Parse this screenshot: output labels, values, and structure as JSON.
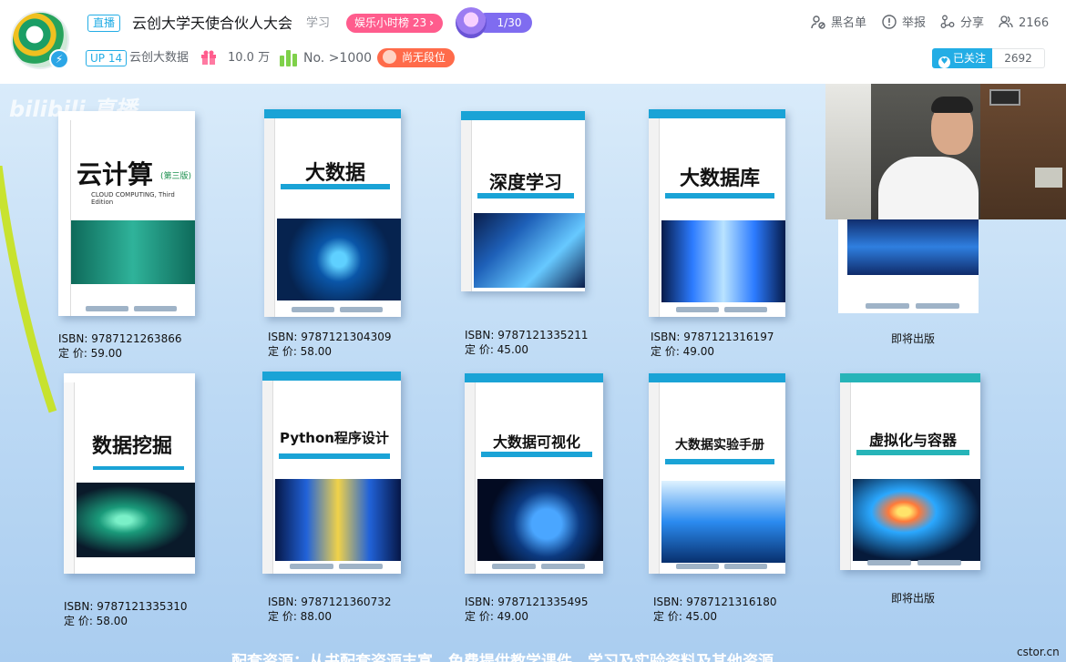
{
  "header": {
    "live_tag": "直播",
    "room_title": "云创大学天使合伙人大会",
    "category": "学习",
    "rank_pill": "娱乐小时榜 23",
    "badge_count": "1/30",
    "up_level": "UP 14",
    "up_name": "云创大数据",
    "gift_value": "10.0 万",
    "rank_no": "No. >1000",
    "tier": "尚无段位",
    "actions": {
      "blacklist": "黑名单",
      "report": "举报",
      "share": "分享",
      "viewers": "2166"
    },
    "follow": {
      "label": "已关注",
      "count": "2692"
    }
  },
  "stream": {
    "watermark": "bilibili 直播",
    "books_top": [
      {
        "title": "云计算",
        "edition": "(第三版)",
        "subtitle": "CLOUD COMPUTING, Third Edition",
        "isbn": "ISBN: 9787121263866",
        "price": "定  价: 59.00"
      },
      {
        "title": "大数据",
        "isbn": "ISBN: 9787121304309",
        "price": "定  价: 58.00"
      },
      {
        "title": "深度学习",
        "isbn": "ISBN: 9787121335211",
        "price": "定  价: 45.00"
      },
      {
        "title": "大数据库",
        "isbn": "ISBN: 9787121316197",
        "price": "定  价: 49.00"
      },
      {
        "title": "",
        "coming": "即将出版"
      }
    ],
    "books_bottom": [
      {
        "title": "数据挖掘",
        "isbn": "ISBN: 9787121335310",
        "price": "定  价: 58.00"
      },
      {
        "title": "Python程序设计",
        "isbn": "ISBN: 9787121360732",
        "price": "定  价: 88.00"
      },
      {
        "title": "大数据可视化",
        "isbn": "ISBN: 9787121335495",
        "price": "定  价: 49.00"
      },
      {
        "title": "大数据实验手册",
        "isbn": "ISBN: 9787121316180",
        "price": "定  价: 45.00"
      },
      {
        "title": "虚拟化与容器",
        "coming": "即将出版"
      }
    ],
    "caption": "配套资源：从书配套资源丰富，免费提供教学课件、学习及实验资料及其他资源",
    "site_watermark": "cstor.cn"
  },
  "colors": {
    "accent": "#23ade5",
    "rank_pink": "#ff5c8d",
    "tier_orange": "#ff6b4a",
    "badge_purple": "#7f6cf0"
  }
}
